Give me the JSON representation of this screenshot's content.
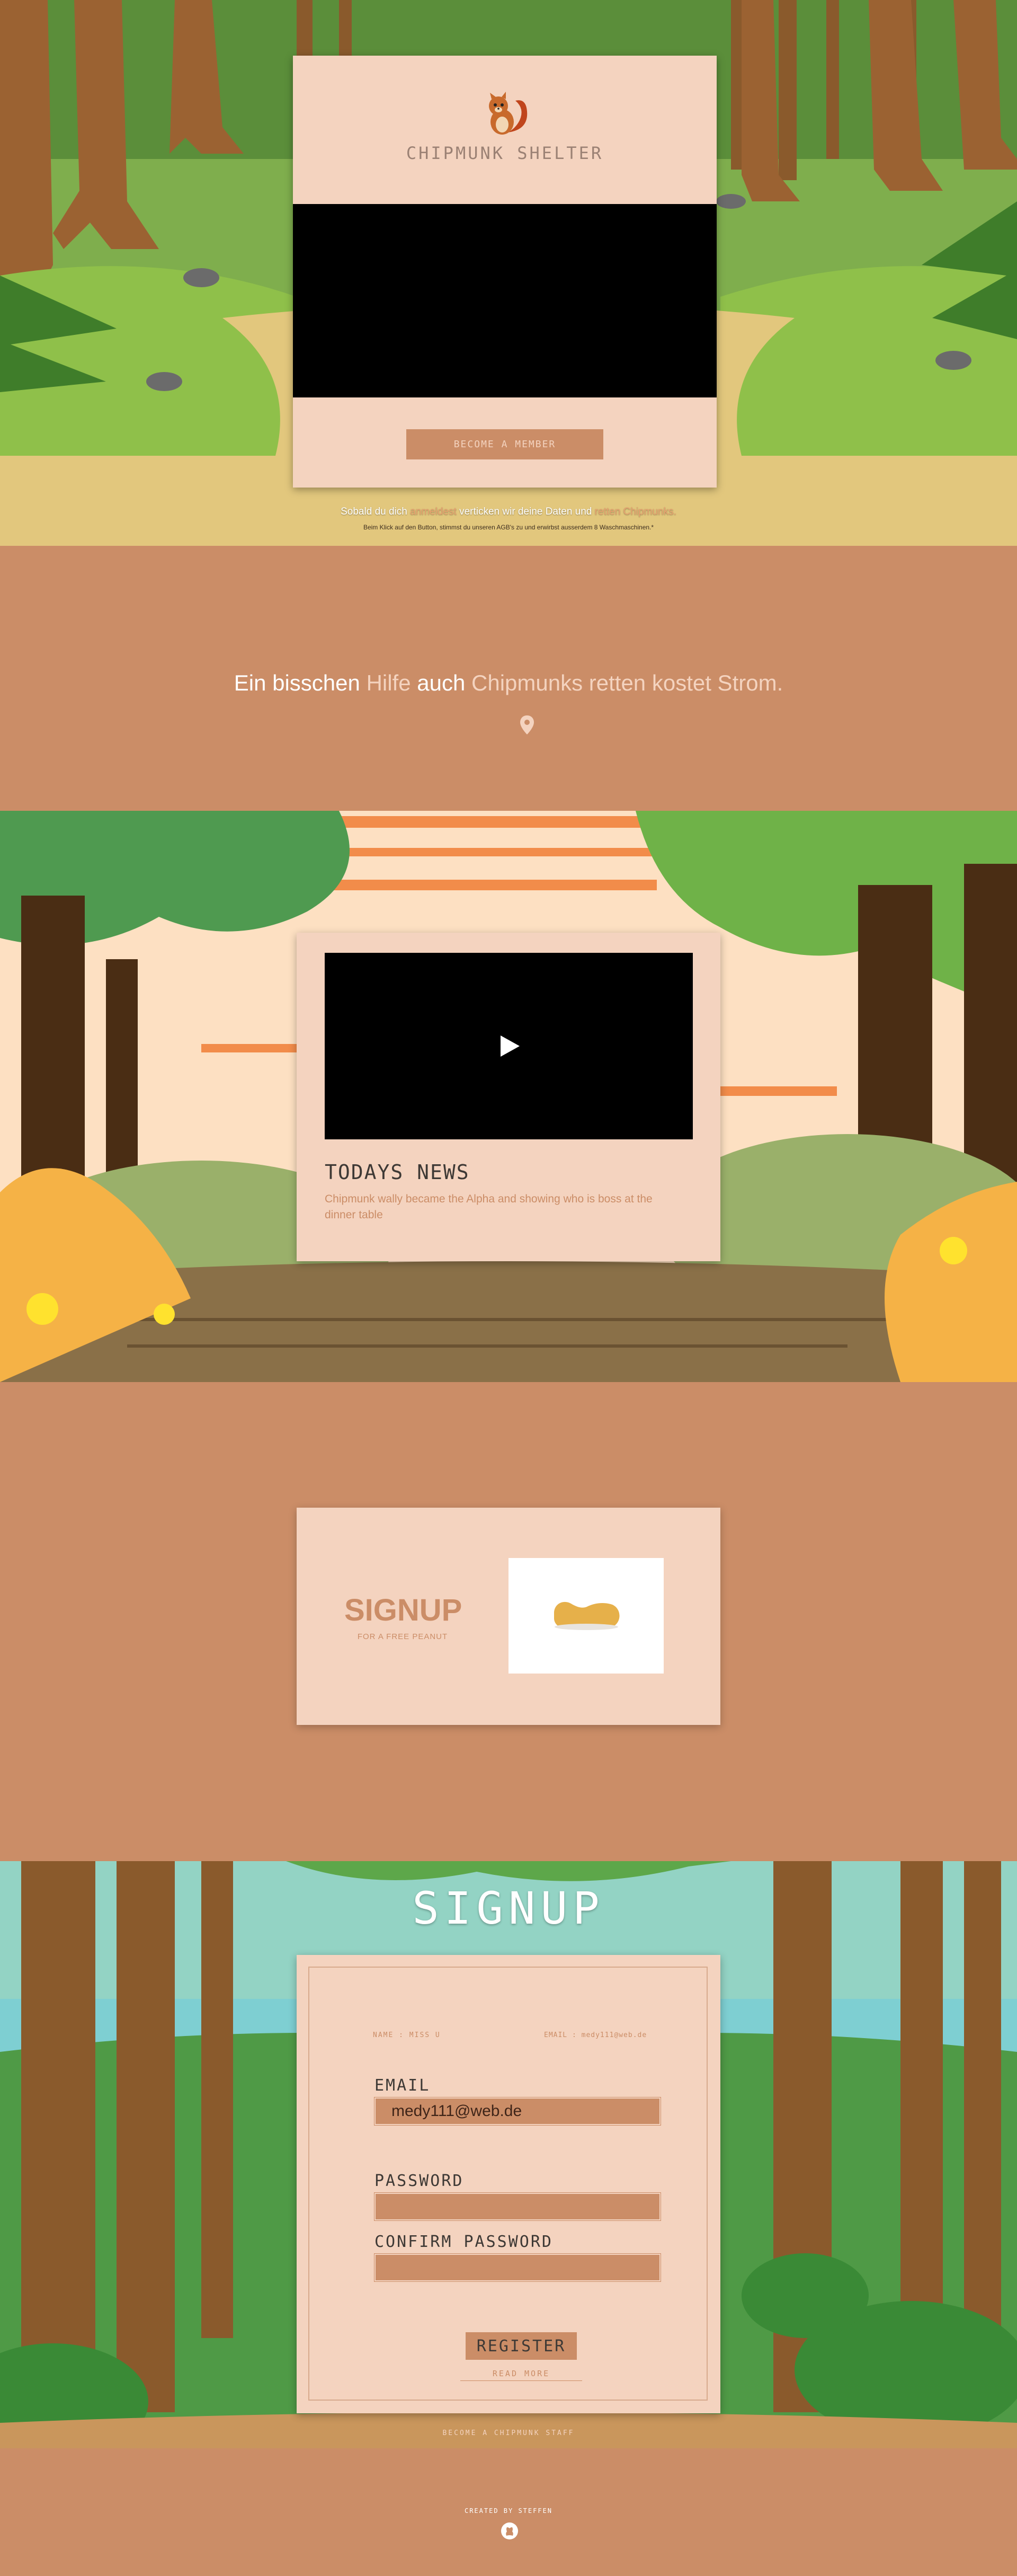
{
  "hero": {
    "title": "CHIPMUNK SHELTER",
    "member_button": "BECOME A MEMBER",
    "caption_1": "Sobald du dich ",
    "caption_hl_1": "anmeldest",
    "caption_2": " verticken wir deine Daten und ",
    "caption_hl_2": "retten Chipmunks.",
    "small_print": "Beim Klick auf den Button, stimmst du unseren AGB's zu und erwirbst ausserdem 8 Waschmaschinen.*"
  },
  "quote": {
    "part_1": "Ein bisschen ",
    "part_2": "Hilfe ",
    "part_3": " auch ",
    "part_4": "Chipmunks retten kostet Strom."
  },
  "news": {
    "title": "TODAYS NEWS",
    "text": "Chipmunk wally became the Alpha and showing who is boss at the dinner table"
  },
  "promo": {
    "title": "SIGNUP",
    "subtitle": "FOR A FREE PEANUT"
  },
  "form": {
    "heading": "SIGNUP",
    "meta_left": "NAME : MISS U",
    "meta_right": "EMAIL : medy111@web.de",
    "email_label": "EMAIL",
    "email_value": "medy111@web.de",
    "password_label": "PASSWORD",
    "password_value": "",
    "confirm_label": "CONFIRM PASSWORD",
    "confirm_value": "",
    "register_button": "REGISTER",
    "read_more": "READ MORE",
    "footer_text": "BECOME A CHIPMUNK STAFF"
  },
  "footer": {
    "credit": "CREATED BY STEFFEN"
  },
  "colors": {
    "brand": "#cb8d67",
    "card": "#f4d3bf",
    "text_dark": "#3e3935"
  },
  "icons": [
    "chipmunk-logo-icon",
    "map-pin-icon",
    "play-icon",
    "peanut-icon",
    "github-icon"
  ]
}
